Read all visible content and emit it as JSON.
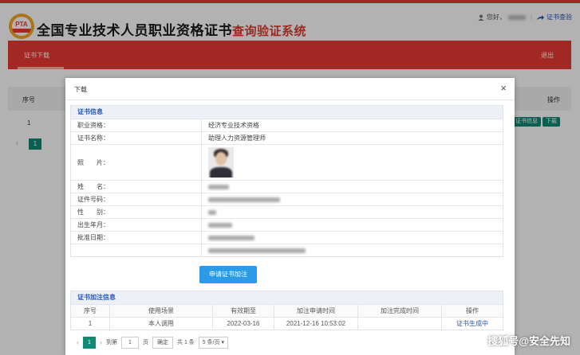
{
  "colors": {
    "brand_red": "#e93a33",
    "link_blue": "#2a55b3",
    "teal": "#0f8a73",
    "button_blue": "#2b9be8"
  },
  "header": {
    "logo_text": "PTA",
    "title": "全国专业技术人员职业资格证书",
    "title_suffix": "查询验证系统",
    "greeting": "您好，",
    "verify_link": "证书查验"
  },
  "nav": {
    "tab": "证书下载",
    "logout": "退出"
  },
  "background_table": {
    "col_index": "序号",
    "col_action": "操作",
    "row_index": "1",
    "btn_info": "证书信息",
    "btn_download": "下载",
    "current_page": "1"
  },
  "modal": {
    "title": "下载",
    "close": "×",
    "cert_section": {
      "heading": "证书信息",
      "fields": [
        {
          "label": "职业资格：",
          "value": "经济专业技术资格"
        },
        {
          "label": "证书名称：",
          "value": "助理人力资源管理师"
        },
        {
          "label": "照　　片：",
          "value": ""
        },
        {
          "label": "姓　　名：",
          "value": ""
        },
        {
          "label": "证件号码：",
          "value": ""
        },
        {
          "label": "性　　别：",
          "value": ""
        },
        {
          "label": "出生年月：",
          "value": ""
        },
        {
          "label": "批准日期：",
          "value": ""
        },
        {
          "label": "",
          "value": ""
        }
      ]
    },
    "apply_button": "申请证书加注",
    "annot_section": {
      "heading": "证书加注信息",
      "columns": [
        "序号",
        "使用场景",
        "有效期至",
        "加注申请时间",
        "加注完成时间",
        "操作"
      ],
      "rows": [
        {
          "index": "1",
          "scene": "本人调用",
          "valid_until": "2022-03-16",
          "apply_time": "2021-12-16 10:53:02",
          "done_time": "",
          "action": "证书生成中"
        }
      ]
    },
    "pager": {
      "prev": "‹",
      "current": "1",
      "next": "›",
      "goto_label": "到第",
      "goto_value": "1",
      "page_unit": "页",
      "confirm": "确定",
      "total": "共 1 条",
      "page_size": "5 条/页"
    }
  },
  "watermark": "搜狐号@安全先知"
}
